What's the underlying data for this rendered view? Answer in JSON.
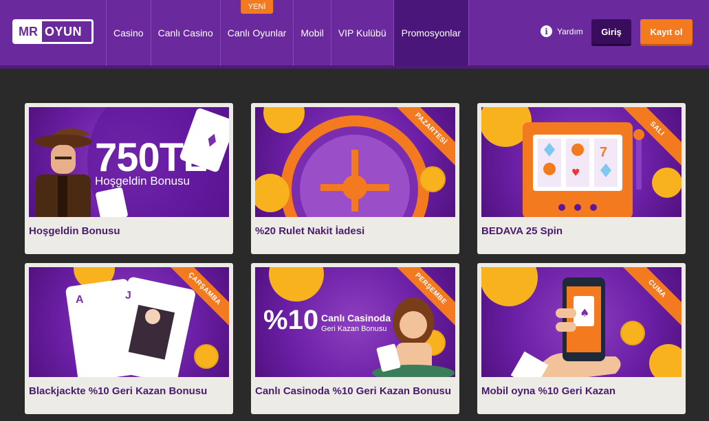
{
  "logo": {
    "part1": "MR",
    "part2": "OYUN"
  },
  "nav": {
    "items": [
      {
        "label": "Casino"
      },
      {
        "label": "Canlı Casino"
      },
      {
        "label": "Canlı Oyunlar",
        "badge": "YENİ"
      },
      {
        "label": "Mobil"
      },
      {
        "label": "VIP Kulübü"
      },
      {
        "label": "Promosyonlar"
      }
    ]
  },
  "header": {
    "help_label": "Yardım",
    "login_label": "Giriş",
    "register_label": "Kayıt ol"
  },
  "promos": [
    {
      "title": "Hoşgeldin Bonusu",
      "banner_amount": "750TL",
      "banner_sub": "Hoşgeldin Bonusu"
    },
    {
      "title": "%20 Rulet Nakit İadesi",
      "ribbon": "PAZARTESİ"
    },
    {
      "title": "BEDAVA 25 Spin",
      "ribbon": "SALI"
    },
    {
      "title": "Blackjackte %10 Geri Kazan Bonusu",
      "ribbon": "ÇARŞAMBA"
    },
    {
      "title": "Canlı Casinoda %10 Geri Kazan Bonusu",
      "ribbon": "PERŞEMBE",
      "banner_big": "%10",
      "banner_line1": "Canlı Casinoda",
      "banner_line2": "Geri Kazan Bonusu"
    },
    {
      "title": "Mobil oyna %10 Geri Kazan",
      "ribbon": "CUMA"
    }
  ],
  "colors": {
    "brand_purple": "#6a2a9e",
    "accent_orange": "#f47a20",
    "login_dark": "#3a0c5e"
  }
}
